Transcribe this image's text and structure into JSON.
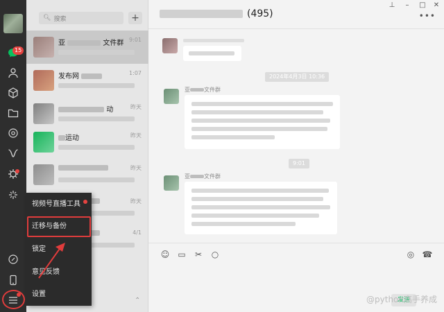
{
  "sidebar": {
    "unread_count": "15",
    "icons": [
      "avatar",
      "chat-icon",
      "contacts-icon",
      "cube-icon",
      "folder-icon",
      "moments-icon",
      "channels-icon",
      "mini-program-icon",
      "spark-icon",
      "link-icon",
      "phone-icon",
      "menu-icon"
    ]
  },
  "search": {
    "placeholder": "搜索",
    "add_label": "+"
  },
  "conversations": [
    {
      "name": "亚",
      "name_suffix": "文件群",
      "time": "9:01"
    },
    {
      "name": "",
      "name_suffix": "发布网",
      "time": "1:07"
    },
    {
      "name": "",
      "name_suffix": "动",
      "time": "昨天"
    },
    {
      "name": "",
      "name_suffix": "运动",
      "time": "昨天"
    },
    {
      "name": "",
      "name_suffix": "",
      "time": "昨天"
    },
    {
      "name": "",
      "name_suffix": "",
      "time": "昨天"
    },
    {
      "name": "",
      "name_suffix": "",
      "time": "4/1"
    }
  ],
  "menu": {
    "items": [
      "视频号直播工具",
      "迁移与备份",
      "锁定",
      "意见反馈",
      "设置"
    ]
  },
  "chat": {
    "title_count": "(495)",
    "timestamp1": "2024年4月3日 10:36",
    "timestamp2": "9:01",
    "sender_prefix": "亚",
    "sender_suffix": "文件群"
  },
  "watermark": "@python高手养成",
  "send_label": "发送"
}
